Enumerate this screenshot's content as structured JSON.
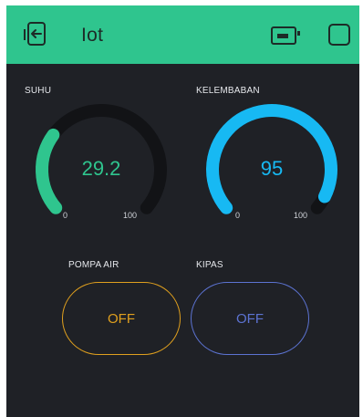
{
  "header": {
    "title": "Iot",
    "back_icon": "back-exit-icon",
    "board_icon": "device-board-icon",
    "stop_icon": "stop-square-icon"
  },
  "gauges": [
    {
      "label": "SUHU",
      "value": "29.2",
      "min": "0",
      "max": "100",
      "fraction": 0.292,
      "color": "#2fc58e"
    },
    {
      "label": "KELEMBABAN",
      "value": "95",
      "min": "0",
      "max": "100",
      "fraction": 0.95,
      "color": "#17b9f3"
    }
  ],
  "buttons": [
    {
      "label": "POMPA AIR",
      "state": "OFF",
      "color": "#e0a01e"
    },
    {
      "label": "KIPAS",
      "state": "OFF",
      "color": "#5c73d2"
    }
  ],
  "colors": {
    "header": "#2fc58e",
    "background": "#1f2126",
    "gauge_track": "#121316"
  }
}
